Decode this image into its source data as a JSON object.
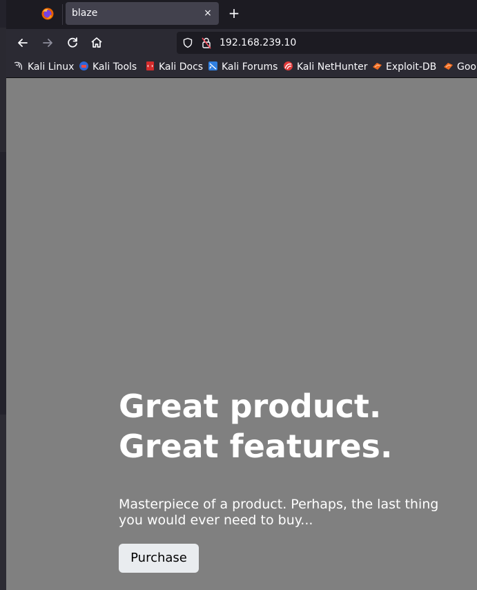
{
  "browser": {
    "tab": {
      "title": "blaze",
      "close_glyph": "×"
    },
    "new_tab_glyph": "+",
    "url": "192.168.239.10",
    "bookmarks": [
      {
        "label": "Kali Linux",
        "icon": "kali-dragon-icon"
      },
      {
        "label": "Kali Tools",
        "icon": "kali-tools-icon"
      },
      {
        "label": "Kali Docs",
        "icon": "kali-docs-icon"
      },
      {
        "label": "Kali Forums",
        "icon": "kali-forums-icon"
      },
      {
        "label": "Kali NetHunter",
        "icon": "kali-nethunter-icon"
      },
      {
        "label": "Exploit-DB",
        "icon": "exploit-db-icon"
      },
      {
        "label": "Goo",
        "icon": "exploit-db-icon"
      }
    ]
  },
  "page": {
    "headline": "Great product.\nGreat features.",
    "headline_line1": "Great product.",
    "headline_line2": "Great features.",
    "lead": "Masterpiece of a product. Perhaps, the last thing you would ever need to buy...",
    "button_label": "Purchase",
    "background_color": "#808080"
  }
}
